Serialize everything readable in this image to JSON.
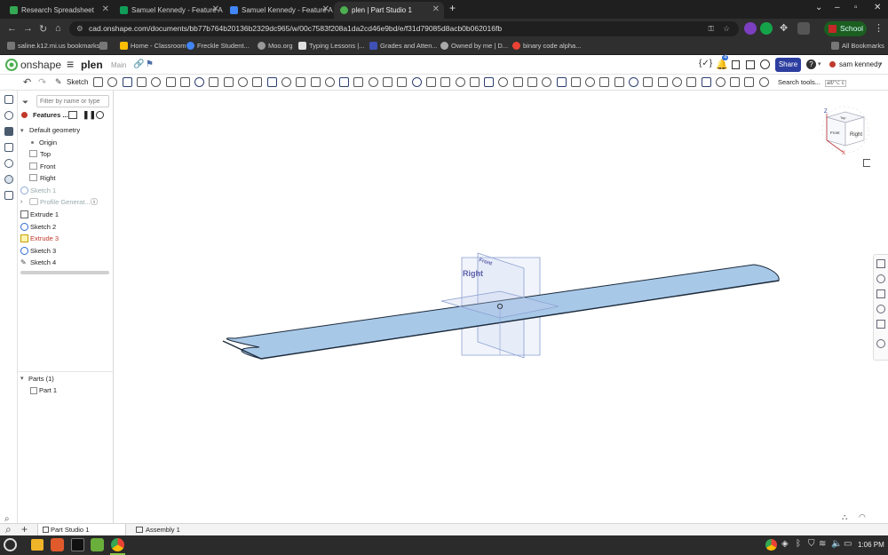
{
  "browser": {
    "tabs": [
      {
        "label": "Research Spreadsheet",
        "color": "#34a853",
        "active": false
      },
      {
        "label": "Samuel Kennedy - Feature A",
        "color": "#0f9d58",
        "active": false
      },
      {
        "label": "Samuel Kennedy - Feature A",
        "color": "#4285f4",
        "active": false
      },
      {
        "label": "plen | Part Studio 1",
        "color": "#4caf50",
        "active": true
      }
    ],
    "new_tab": "+",
    "window_controls": [
      "⌄",
      "–",
      "▫",
      "✕"
    ],
    "url": "cad.onshape.com/documents/bb77b764b20136b2329dc965/w/00c7583f208a1da2cd46e9bd/e/f31d79085d8acb0b062016fb",
    "profile_label": "School",
    "bookmarks": [
      {
        "label": "saline.k12.mi.us bookmarks",
        "color": "#777"
      },
      {
        "label": "",
        "color": "#777"
      },
      {
        "label": "Home - Classroom",
        "color": "#fbbc04"
      },
      {
        "label": "Freckle Student...",
        "color": "#4285f4"
      },
      {
        "label": "Moo.org",
        "color": "#999"
      },
      {
        "label": "Typing Lessons |...",
        "color": "#e0e0e0"
      },
      {
        "label": "Grades and Atten...",
        "color": "#3f51b5"
      },
      {
        "label": "Owned by me | D...",
        "color": "#aaa"
      },
      {
        "label": "binary code alpha...",
        "color": "#ea4335"
      }
    ],
    "all_bookmarks": "All Bookmarks"
  },
  "onshape": {
    "logo_text": "onshape",
    "doc_name": "plen",
    "branch": "Main",
    "notification_count": "4",
    "share_label": "Share",
    "user_name": "sam kennedy",
    "sketch_label": "Sketch",
    "search_tools_label": "Search tools...",
    "search_shortcut": "alt/⌥ c"
  },
  "feature_panel": {
    "filter_placeholder": "Filter by name or type",
    "header_label": "Features ...",
    "items": [
      {
        "label": "Default geometry",
        "kind": "group"
      },
      {
        "label": "Origin",
        "kind": "origin"
      },
      {
        "label": "Top",
        "kind": "plane"
      },
      {
        "label": "Front",
        "kind": "plane"
      },
      {
        "label": "Right",
        "kind": "plane"
      },
      {
        "label": "Sketch 1",
        "kind": "sketch-hidden"
      },
      {
        "label": "Profile Generat...",
        "kind": "custom-hidden"
      },
      {
        "label": "Extrude 1",
        "kind": "extrude"
      },
      {
        "label": "Sketch 2",
        "kind": "sketch"
      },
      {
        "label": "Extrude 3",
        "kind": "extrude-error"
      },
      {
        "label": "Sketch 3",
        "kind": "sketch"
      },
      {
        "label": "Sketch 4",
        "kind": "sketch-plain"
      }
    ],
    "parts_header": "Parts (1)",
    "parts": [
      "Part 1"
    ]
  },
  "viewport": {
    "plane_label_right": "Right",
    "plane_label_front": "Front",
    "view_cube_top": "Top",
    "view_cube_right": "Right",
    "view_cube_front": "Front",
    "axis_z": "Z",
    "axis_x": "X",
    "wing_color": "#a8c8e8"
  },
  "bottom_tabs": {
    "add": "+",
    "tabs": [
      "Part Studio 1",
      "Assembly 1"
    ]
  },
  "taskbar": {
    "time": "1:06 PM"
  }
}
